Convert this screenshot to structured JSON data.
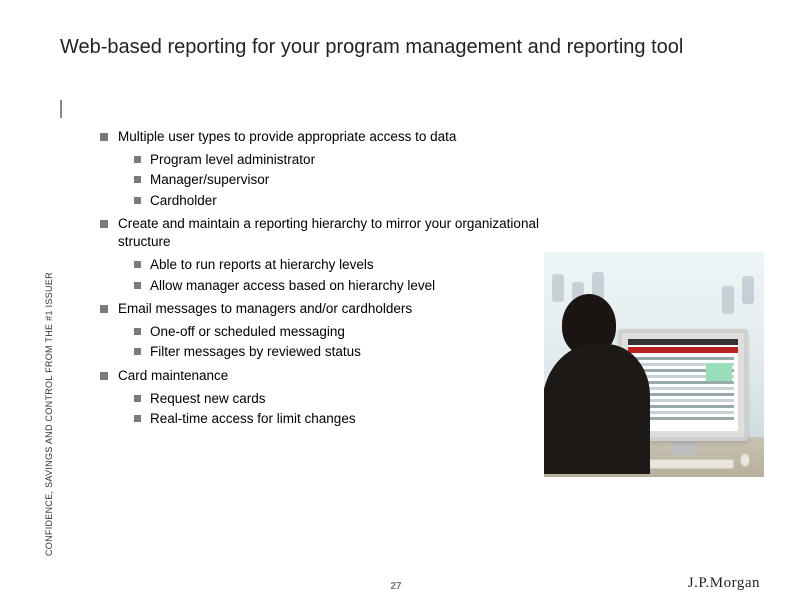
{
  "title": "Web-based reporting for your program management and reporting tool",
  "sidebar_text": "CONFIDENCE, SAVINGS AND CONTROL FROM THE #1 ISSUER",
  "page_number": "27",
  "brand": "J.P.Morgan",
  "bullets": [
    {
      "text": "Multiple user types to provide appropriate access to data",
      "sub": [
        "Program level administrator",
        "Manager/supervisor",
        "Cardholder"
      ]
    },
    {
      "text": "Create and maintain a reporting hierarchy to mirror your organizational structure",
      "sub": [
        "Able to run reports at hierarchy levels",
        "Allow manager access based on hierarchy level"
      ]
    },
    {
      "text": "Email messages to managers and/or cardholders",
      "sub": [
        "One-off or scheduled messaging",
        "Filter messages by reviewed status"
      ]
    },
    {
      "text": "Card maintenance",
      "sub": [
        "Request new cards",
        "Real-time access for limit changes"
      ]
    }
  ]
}
